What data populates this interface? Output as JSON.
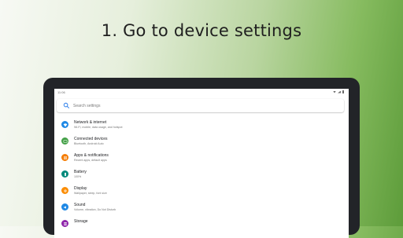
{
  "headline": "1. Go to device settings",
  "status_bar": {
    "time": "11:06"
  },
  "search": {
    "placeholder": "Search settings"
  },
  "settings": [
    {
      "title": "Network & internet",
      "subtitle": "Wi-Fi, mobile, data usage, and hotspot",
      "icon": "wifi-icon",
      "color": "#1e88e5"
    },
    {
      "title": "Connected devices",
      "subtitle": "Bluetooth, Android Auto",
      "icon": "devices-icon",
      "color": "#43a047"
    },
    {
      "title": "Apps & notifications",
      "subtitle": "Recent apps, default apps",
      "icon": "apps-icon",
      "color": "#f57c00"
    },
    {
      "title": "Battery",
      "subtitle": "100%",
      "icon": "battery-icon",
      "color": "#00897b"
    },
    {
      "title": "Display",
      "subtitle": "Wallpaper, sleep, font size",
      "icon": "display-icon",
      "color": "#fb8c00"
    },
    {
      "title": "Sound",
      "subtitle": "Volume, vibration, Do Not Disturb",
      "icon": "sound-icon",
      "color": "#1e88e5"
    },
    {
      "title": "Storage",
      "subtitle": "",
      "icon": "storage-icon",
      "color": "#8e24aa"
    }
  ]
}
